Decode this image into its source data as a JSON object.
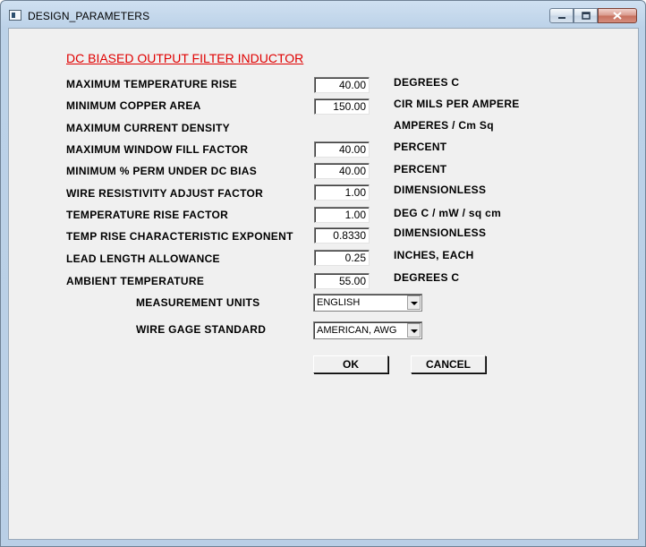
{
  "window": {
    "title": "DESIGN_PARAMETERS",
    "icons": {
      "app": "app-window-icon",
      "minimize": "minimize-icon",
      "maximize": "maximize-icon",
      "close": "close-icon"
    }
  },
  "heading": "DC BIASED OUTPUT FILTER INDUCTOR",
  "params": [
    {
      "label": "MAXIMUM TEMPERATURE RISE",
      "value": "40.00",
      "unit": "DEGREES C"
    },
    {
      "label": "MINIMUM COPPER AREA",
      "value": "150.00",
      "unit": "CIR MILS PER AMPERE"
    },
    {
      "label": "MAXIMUM CURRENT DENSITY",
      "value": null,
      "unit": "AMPERES / Cm Sq"
    },
    {
      "label": "MAXIMUM WINDOW FILL FACTOR",
      "value": "40.00",
      "unit": "PERCENT"
    },
    {
      "label": "MINIMUM % PERM UNDER DC BIAS",
      "value": "40.00",
      "unit": "PERCENT"
    },
    {
      "label": "WIRE RESISTIVITY ADJUST FACTOR",
      "value": "1.00",
      "unit": "DIMENSIONLESS"
    },
    {
      "label": "TEMPERATURE RISE FACTOR",
      "value": "1.00",
      "unit": "DEG C  / mW / sq cm"
    },
    {
      "label": "TEMP RISE CHARACTERISTIC EXPONENT",
      "value": "0.8330",
      "unit": "DIMENSIONLESS"
    },
    {
      "label": "LEAD LENGTH ALLOWANCE",
      "value": "0.25",
      "unit": "INCHES, EACH"
    },
    {
      "label": "AMBIENT TEMPERATURE",
      "value": "55.00",
      "unit": "DEGREES C"
    }
  ],
  "measurement_units": {
    "label": "MEASUREMENT UNITS",
    "selected": "ENGLISH"
  },
  "wire_gage": {
    "label": "WIRE GAGE STANDARD",
    "selected": "AMERICAN, AWG"
  },
  "buttons": {
    "ok": "OK",
    "cancel": "CANCEL"
  },
  "colors": {
    "heading": "#e00000",
    "client_bg": "#f0f0f0",
    "frame": "#bcd2e8"
  }
}
